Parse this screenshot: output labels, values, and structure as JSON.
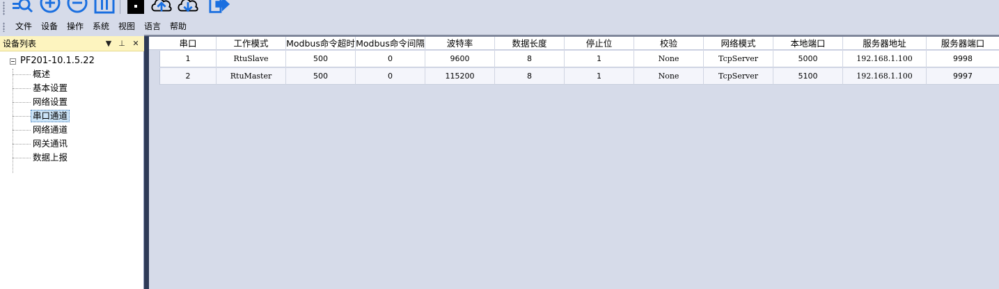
{
  "toolbar": {
    "buttons": [
      {
        "name": "search-list-icon"
      },
      {
        "name": "add-circle-icon"
      },
      {
        "name": "remove-circle-icon"
      },
      {
        "name": "pause-icon"
      },
      {
        "name": "lock-icon"
      },
      {
        "name": "cloud-upload-icon"
      },
      {
        "name": "cloud-download-icon"
      },
      {
        "name": "exit-arrow-icon"
      }
    ],
    "accent": "#1a6fe0"
  },
  "menu": {
    "items": [
      "文件",
      "设备",
      "操作",
      "系统",
      "视图",
      "语言",
      "帮助"
    ]
  },
  "left_panel": {
    "title": "设备列表",
    "controls": [
      "▼",
      "⊥",
      "✕"
    ],
    "header_color": "#fdf4bf",
    "tree": {
      "root": "PF201-10.1.5.22",
      "children": [
        "概述",
        "基本设置",
        "网络设置",
        "串口通道",
        "网络通道",
        "网关通讯",
        "数据上报"
      ],
      "selected_index": 3
    }
  },
  "grid": {
    "columns": [
      "串口",
      "工作模式",
      "Modbus命令超时",
      "Modbus命令间隔",
      "波特率",
      "数据长度",
      "停止位",
      "校验",
      "网络模式",
      "本地端口",
      "服务器地址",
      "服务器端口"
    ],
    "rows": [
      [
        "1",
        "RtuSlave",
        "500",
        "0",
        "9600",
        "8",
        "1",
        "None",
        "TcpServer",
        "5000",
        "192.168.1.100",
        "9998"
      ],
      [
        "2",
        "RtuMaster",
        "500",
        "0",
        "115200",
        "8",
        "1",
        "None",
        "TcpServer",
        "5100",
        "192.168.1.100",
        "9997"
      ]
    ]
  }
}
